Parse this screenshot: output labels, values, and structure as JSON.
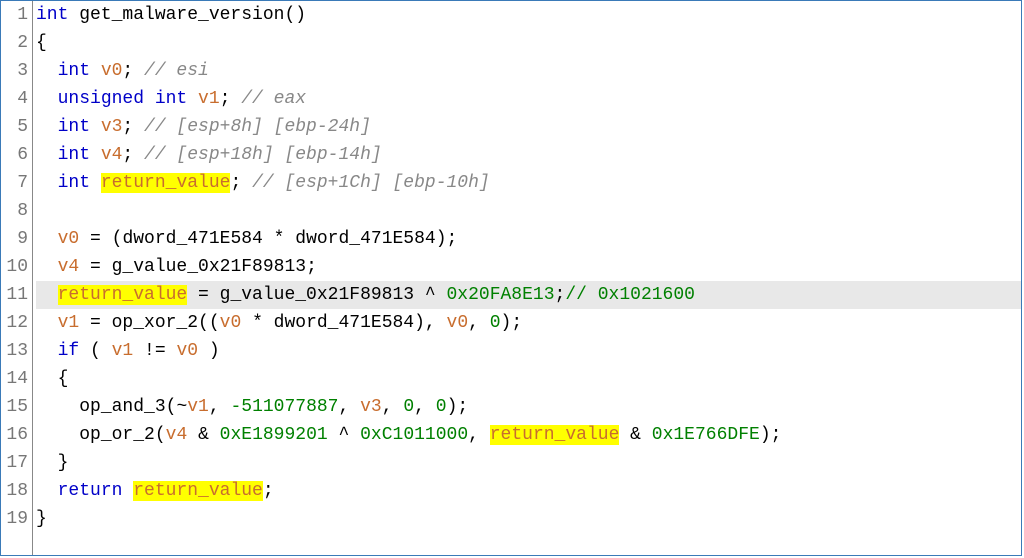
{
  "lines": {
    "l1_kw1": "int",
    "l1_fn": " get_malware_version",
    "l1_p": "()",
    "l2": "{",
    "l3_kw": "int",
    "l3_var": " v0",
    "l3_p": "; ",
    "l3_cmt": "// esi",
    "l4_kw": "unsigned int",
    "l4_var": " v1",
    "l4_p": "; ",
    "l4_cmt": "// eax",
    "l5_kw": "int",
    "l5_var": " v3",
    "l5_p": "; ",
    "l5_cmt": "// [esp+8h] [ebp-24h]",
    "l6_kw": "int",
    "l6_var": " v4",
    "l6_p": "; ",
    "l6_cmt": "// [esp+18h] [ebp-14h]",
    "l7_kw": "int",
    "l7_sp": " ",
    "l7_rv": "return_value",
    "l7_p": "; ",
    "l7_cmt": "// [esp+1Ch] [ebp-10h]",
    "l9_v0": "v0",
    "l9_eq": " = (",
    "l9_g1": "dword_471E584",
    "l9_mul": " * ",
    "l9_g2": "dword_471E584",
    "l9_end": ");",
    "l10_v4": "v4",
    "l10_eq": " = ",
    "l10_g": "g_value_0x21F89813",
    "l10_end": ";",
    "l11_rv": "return_value",
    "l11_eq": " = ",
    "l11_g": "g_value_0x21F89813",
    "l11_xor": " ^ ",
    "l11_hex": "0x20FA8E13",
    "l11_semi": ";",
    "l11_cmt": "// 0x1021600",
    "l12_v1": "v1",
    "l12_eq": " = ",
    "l12_fn": "op_xor_2",
    "l12_open": "((",
    "l12_v0a": "v0",
    "l12_mul": " * ",
    "l12_g": "dword_471E584",
    "l12_mid": "), ",
    "l12_v0b": "v0",
    "l12_c": ", ",
    "l12_zero": "0",
    "l12_end": ");",
    "l13_if": "if",
    "l13_open": " ( ",
    "l13_v1": "v1",
    "l13_neq": " != ",
    "l13_v0": "v0",
    "l13_close": " )",
    "l14": "{",
    "l15_fn": "op_and_3",
    "l15_open": "(~",
    "l15_v1": "v1",
    "l15_c1": ", ",
    "l15_n1": "-511077887",
    "l15_c2": ", ",
    "l15_v3": "v3",
    "l15_c3": ", ",
    "l15_z1": "0",
    "l15_c4": ", ",
    "l15_z2": "0",
    "l15_end": ");",
    "l16_fn": "op_or_2",
    "l16_open": "(",
    "l16_v4": "v4",
    "l16_amp1": " & ",
    "l16_h1": "0xE1899201",
    "l16_xor": " ^ ",
    "l16_h2": "0xC1011000",
    "l16_c": ", ",
    "l16_rv": "return_value",
    "l16_amp2": " & ",
    "l16_h3": "0x1E766DFE",
    "l16_end": ");",
    "l17": "}",
    "l18_ret": "return",
    "l18_sp": " ",
    "l18_rv": "return_value",
    "l18_end": ";",
    "l19": "}"
  },
  "gutter": [
    "1",
    "2",
    "3",
    "4",
    "5",
    "6",
    "7",
    "8",
    "9",
    "10",
    "11",
    "12",
    "13",
    "14",
    "15",
    "16",
    "17",
    "18",
    "19"
  ]
}
